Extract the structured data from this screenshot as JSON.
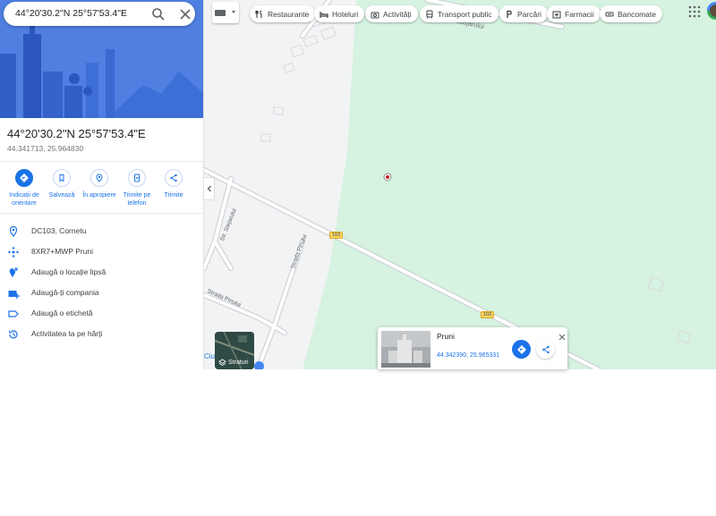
{
  "search": {
    "query": "44°20'30.2\"N 25°57'53.4\"E",
    "search_icon": "search-icon",
    "close_icon": "close-icon"
  },
  "place": {
    "title": "44°20'30.2\"N 25°57'53.4\"E",
    "coords": "44.341713, 25.964830"
  },
  "actions": [
    {
      "label": "Indicații de orientare",
      "icon": "directions-icon"
    },
    {
      "label": "Salvează",
      "icon": "bookmark-icon"
    },
    {
      "label": "În apropiere",
      "icon": "nearby-icon"
    },
    {
      "label": "Trimite pe telefon",
      "icon": "send-to-phone-icon"
    },
    {
      "label": "Trimite",
      "icon": "share-icon"
    }
  ],
  "info_rows": [
    {
      "text": "DC103, Cornetu",
      "icon": "location-pin-icon"
    },
    {
      "text": "8XR7+MWP Pruni",
      "icon": "plus-code-icon"
    },
    {
      "text": "Adaugă o locație lipsă",
      "icon": "add-location-icon"
    },
    {
      "text": "Adaugă-ți compania",
      "icon": "add-business-icon"
    },
    {
      "text": "Adaugă o etichetă",
      "icon": "label-icon"
    },
    {
      "text": "Activitatea ta pe hărți",
      "icon": "history-icon"
    }
  ],
  "chips": [
    {
      "label": "Restaurante",
      "icon": "restaurant-icon"
    },
    {
      "label": "Hoteluri",
      "icon": "hotel-icon"
    },
    {
      "label": "Activități",
      "icon": "camera-icon"
    },
    {
      "label": "Transport public",
      "icon": "transit-icon"
    },
    {
      "label": "Parcări",
      "icon": "parking-icon"
    },
    {
      "label": "Farmacii",
      "icon": "pharmacy-icon"
    },
    {
      "label": "Bancomate",
      "icon": "atm-icon"
    }
  ],
  "map": {
    "street_labels": [
      "Str. Stejarului",
      "Strada Pinului",
      "Strada Pinului",
      "Stejarului"
    ],
    "road_shields": [
      "103",
      "103"
    ],
    "poi_partial_label": "Ciu...mia",
    "layers_label": "Straturi"
  },
  "card": {
    "name": "Pruni",
    "coords": "44.342390, 25.965331"
  },
  "colors": {
    "accent": "#1a73e8",
    "hero": "#4f7fe0",
    "park": "#d6f2e0",
    "road": "#ffffff",
    "road_outline": "#c8cdd2",
    "map_bg": "#f2f3f4"
  }
}
